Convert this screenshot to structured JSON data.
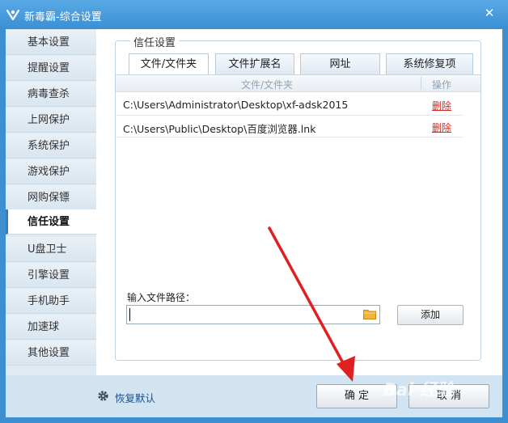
{
  "window": {
    "title": "新毒霸-综合设置",
    "close_label": "✕"
  },
  "sidebar": {
    "items": [
      {
        "label": "基本设置"
      },
      {
        "label": "提醒设置"
      },
      {
        "label": "病毒查杀"
      },
      {
        "label": "上网保护"
      },
      {
        "label": "系统保护"
      },
      {
        "label": "游戏保护"
      },
      {
        "label": "网购保镖"
      },
      {
        "label": "信任设置",
        "active": true
      },
      {
        "label": "U盘卫士"
      },
      {
        "label": "引擎设置"
      },
      {
        "label": "手机助手"
      },
      {
        "label": "加速球"
      },
      {
        "label": "其他设置"
      }
    ]
  },
  "trust": {
    "legend": "信任设置",
    "tabs": [
      {
        "label": "文件/文件夹",
        "active": true
      },
      {
        "label": "文件扩展名"
      },
      {
        "label": "网址"
      },
      {
        "label": "系统修复项"
      }
    ],
    "columns": {
      "path": "文件/文件夹",
      "action": "操作"
    },
    "rows": [
      {
        "path": "C:\\Users\\Administrator\\Desktop\\xf-adsk2015",
        "action": "删除"
      },
      {
        "path": "C:\\Users\\Public\\Desktop\\百度浏览器.lnk",
        "action": "删除"
      }
    ],
    "input_label": "输入文件路径：",
    "input_value": "",
    "add_label": "添加"
  },
  "footer": {
    "restore_label": "恢复默认",
    "ok_label": "确 定",
    "cancel_label": "取 消"
  },
  "watermark": "Bai 经验",
  "colors": {
    "title_bar": "#3a8fd3",
    "delete_link": "#d3261c",
    "arrow": "#e02020"
  }
}
